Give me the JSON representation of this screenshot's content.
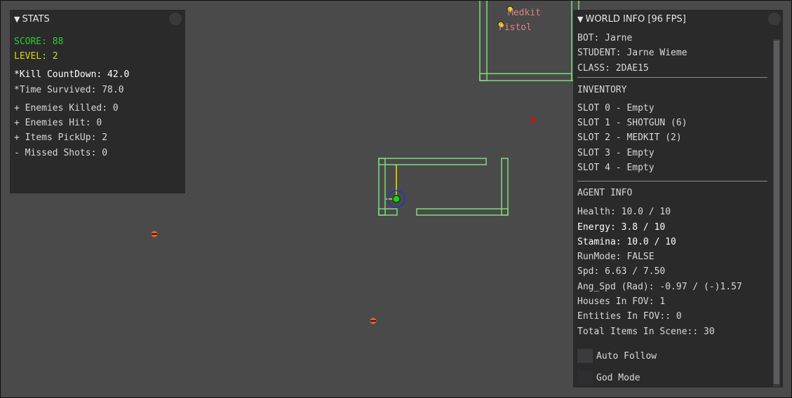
{
  "stats": {
    "title": "STATS",
    "score": "SCORE: 88",
    "level": "LEVEL: 2",
    "kill_countdown": "*Kill CountDown: 42.0",
    "time_survived": "*Time Survived: 78.0",
    "enemies_killed": "+ Enemies Killed: 0",
    "enemies_hit": "+ Enemies Hit: 0",
    "items_pickup": "+ Items PickUp: 2",
    "missed_shots": "- Missed Shots: 0"
  },
  "world_info": {
    "title": "WORLD INFO [96 FPS]",
    "bot": "BOT: Jarne",
    "student": "STUDENT: Jarne Wieme",
    "class": "CLASS: 2DAE15",
    "inventory_header": "INVENTORY",
    "slots": [
      "SLOT 0 - Empty",
      "SLOT 1 - SHOTGUN (6)",
      "SLOT 2 - MEDKIT (2)",
      "SLOT 3 - Empty",
      "SLOT 4 - Empty"
    ],
    "agent_header": "AGENT INFO",
    "health": "Health: 10.0 / 10",
    "energy": "Energy: 3.8 / 10",
    "stamina": "Stamina: 10.0 / 10",
    "run_mode": "RunMode: FALSE",
    "speed": "Spd: 6.63 / 7.50",
    "ang_speed": "Ang_Spd (Rad): -0.97 / (-)1.57",
    "houses_in_fov": "Houses In FOV: 1",
    "entities_in_fov": "Entities In FOV:: 0",
    "total_items": "Total Items In Scene:: 30",
    "auto_follow_label": "Auto Follow",
    "god_mode_label": "God Mode",
    "auto_follow_checked": false,
    "god_mode_checked": false
  },
  "world": {
    "item_labels": [
      "Medkit",
      "Pistol"
    ],
    "colors": {
      "background": "#4a4a4a",
      "house_walls": "#7ddc7d",
      "agent": "#22cc22",
      "agent_ring": "#2233cc",
      "view_direction": "#e6e600",
      "enemy": "#e06030",
      "item_marker": "#e6e600",
      "purge_zone": "#cc1111",
      "item_label": "#e08080"
    }
  }
}
